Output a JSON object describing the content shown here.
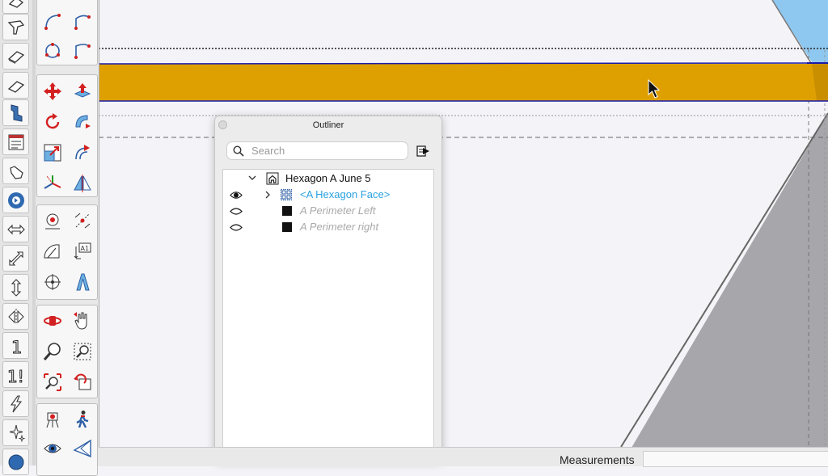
{
  "outliner": {
    "title": "Outliner",
    "search_placeholder": "Search",
    "items": [
      {
        "label": "Hexagon A June 5",
        "kind": "model"
      },
      {
        "label": "<A Hexagon Face>",
        "kind": "group"
      },
      {
        "label": "A Perimeter Left",
        "kind": "hidden-entity"
      },
      {
        "label": "A Perimeter right",
        "kind": "hidden-entity"
      }
    ]
  },
  "status": {
    "measurements_label": "Measurements",
    "measurements_value": ""
  },
  "colors": {
    "face_fill": "#dea000",
    "selection_edge": "#1a1aa8",
    "group_link": "#2aa1e0",
    "hidden_text": "#a9a9a9",
    "grey_face": "#a6a6ab",
    "sky": "#8ec8f0"
  },
  "icons": {
    "left_toolbar": [
      "eraser-icon",
      "paint-bucket-icon",
      "tag-eraser-icon",
      "eraser-alt-icon",
      "tag-tool-icon",
      "entity-info-icon",
      "hand-icon",
      "sync-icon",
      "width-arrow-icon",
      "scale-diagonal-icon",
      "height-arrow-icon",
      "flip-icon",
      "number-one-icon",
      "number-one-bang-icon",
      "lightning-icon",
      "sparkles-icon",
      "glass-icon"
    ],
    "palette": [
      "arc-icon",
      "arc-pie-icon",
      "circle-arc-icon",
      "three-point-arc-icon",
      "move-icon",
      "push-pull-icon",
      "rotate-icon",
      "follow-me-icon",
      "scale-icon",
      "offset-icon",
      "axes-icon",
      "flip-along-icon",
      "tape-measure-icon",
      "dimension-icon",
      "protractor-icon",
      "text-icon",
      "axes-target-icon",
      "3d-text-icon",
      "orbit-icon",
      "pan-icon",
      "zoom-icon",
      "zoom-window-icon",
      "zoom-extents-icon",
      "previous-view-icon",
      "position-camera-icon",
      "walk-icon",
      "look-around-icon",
      "section-plane-icon"
    ]
  }
}
